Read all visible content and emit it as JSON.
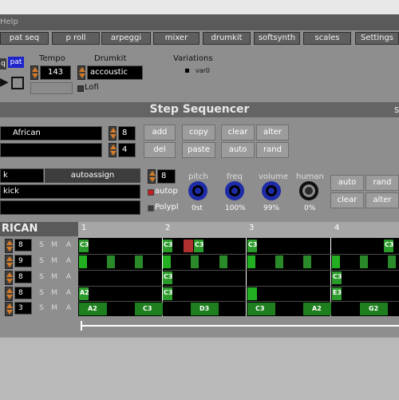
{
  "menu": {
    "help": "Help"
  },
  "nav": [
    "pat seq",
    "p roll",
    "arpeggi",
    "mixer",
    "drumkit",
    "softsynth",
    "scales",
    "Settings"
  ],
  "transport": {
    "seq_label": "q",
    "pat_label": "pat",
    "tempo_label": "Tempo",
    "tempo_value": "143",
    "drumkit_label": "Drumkit",
    "drumkit_value": "accoustic",
    "lofi_label": "Lofi",
    "variations_label": "Variations",
    "variation_item": "var0"
  },
  "sequencer": {
    "title": "Step Sequencer",
    "title_right": "s",
    "pattern_name": "African",
    "steps_value": "8",
    "beats_value": "4",
    "buttons": [
      "add",
      "copy",
      "clear",
      "alter",
      "del",
      "paste",
      "auto",
      "rand"
    ]
  },
  "instrument": {
    "left_field": "k",
    "autoassign": "autoassign",
    "kit_field": "kick",
    "value": "8",
    "autop": "autop",
    "polyp": "Polypl",
    "knobs": [
      {
        "label": "pitch",
        "value": "0st"
      },
      {
        "label": "freq",
        "value": "100%"
      },
      {
        "label": "volume",
        "value": "99%"
      },
      {
        "label": "human",
        "value": "0%"
      }
    ],
    "side_buttons": [
      "auto",
      "rand",
      "clear",
      "alter"
    ]
  },
  "grid": {
    "header": "RICAN",
    "beats": [
      "1",
      "2",
      "3",
      "4"
    ],
    "rows": [
      {
        "value": "8",
        "s": "S",
        "m": "M",
        "a": "A"
      },
      {
        "value": "9",
        "s": "S",
        "m": "M",
        "a": "A"
      },
      {
        "value": "8",
        "s": "S",
        "m": "M",
        "a": "A"
      },
      {
        "value": "8",
        "s": "S",
        "m": "M",
        "a": "A"
      },
      {
        "value": "3",
        "s": "S",
        "m": "M",
        "a": "A"
      }
    ],
    "notes": [
      "C3",
      "C3",
      "C3",
      "C3",
      "C3",
      "C3",
      "C3",
      "A2",
      "C3",
      "E3",
      "A2",
      "C3",
      "D3",
      "C3",
      "A2",
      "G2"
    ]
  },
  "colors": {
    "accent": "#1e24c9",
    "green": "#22a233",
    "red": "#b03030",
    "orange": "#d47a28"
  }
}
